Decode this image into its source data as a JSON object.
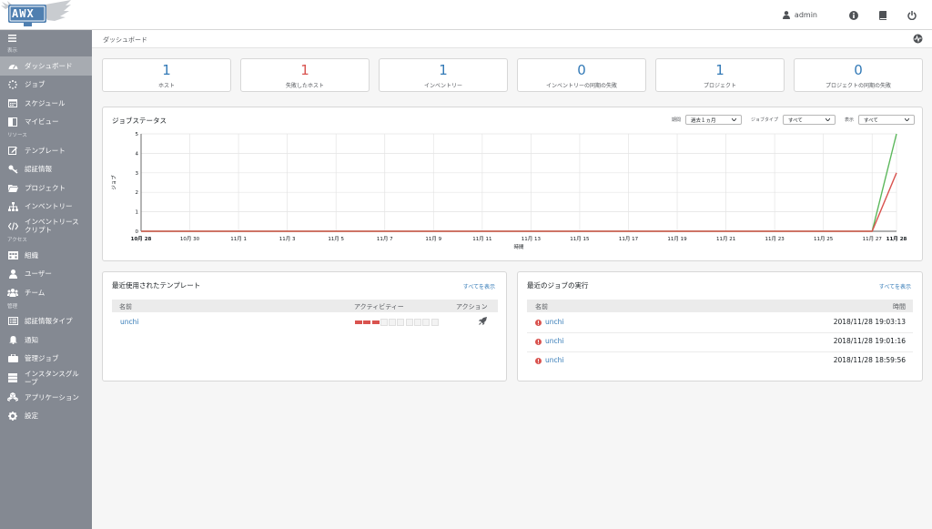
{
  "header": {
    "logo_text": "AWX",
    "username": "admin"
  },
  "sidebar": {
    "sections": [
      {
        "label": "表示",
        "items": [
          {
            "label": "ダッシュボード",
            "icon": "tachometer-icon",
            "active": true
          },
          {
            "label": "ジョブ",
            "icon": "spinner-icon"
          },
          {
            "label": "スケジュール",
            "icon": "calendar-icon"
          },
          {
            "label": "マイビュー",
            "icon": "columns-icon"
          }
        ]
      },
      {
        "label": "リソース",
        "items": [
          {
            "label": "テンプレート",
            "icon": "pencil-square-icon"
          },
          {
            "label": "認証情報",
            "icon": "key-icon"
          },
          {
            "label": "プロジェクト",
            "icon": "folder-icon"
          },
          {
            "label": "インベントリー",
            "icon": "sitemap-icon"
          },
          {
            "label": "インベントリースクリプト",
            "icon": "code-icon"
          }
        ]
      },
      {
        "label": "アクセス",
        "items": [
          {
            "label": "組織",
            "icon": "building-icon"
          },
          {
            "label": "ユーザー",
            "icon": "user-icon"
          },
          {
            "label": "チーム",
            "icon": "users-icon"
          }
        ]
      },
      {
        "label": "管理",
        "items": [
          {
            "label": "認証情報タイプ",
            "icon": "list-alt-icon"
          },
          {
            "label": "通知",
            "icon": "bell-icon"
          },
          {
            "label": "管理ジョブ",
            "icon": "briefcase-icon"
          },
          {
            "label": "インスタンスグループ",
            "icon": "server-icon"
          },
          {
            "label": "アプリケーション",
            "icon": "cubes-icon"
          },
          {
            "label": "設定",
            "icon": "cog-icon"
          }
        ]
      }
    ]
  },
  "breadcrumb": "ダッシュボード",
  "counts": [
    {
      "value": "1",
      "label": "ホスト"
    },
    {
      "value": "1",
      "label": "失敗したホスト",
      "status": "fail"
    },
    {
      "value": "1",
      "label": "インベントリー"
    },
    {
      "value": "0",
      "label": "インベントリーの同期の失敗"
    },
    {
      "value": "1",
      "label": "プロジェクト"
    },
    {
      "value": "0",
      "label": "プロジェクトの同期の失敗"
    }
  ],
  "job_status": {
    "title": "ジョブステータス",
    "filters": {
      "period_label": "期間",
      "period_value": "過去１ヵ月",
      "job_type_label": "ジョブタイプ",
      "job_type_value": "すべて",
      "view_label": "表示",
      "view_value": "すべて"
    }
  },
  "chart_data": {
    "type": "line",
    "xlabel": "時間",
    "ylabel": "ジョブ",
    "x_tick_labels": [
      "10月 28",
      "10月 30",
      "11月 1",
      "11月 3",
      "11月 5",
      "11月 7",
      "11月 9",
      "11月 11",
      "11月 13",
      "11月 15",
      "11月 17",
      "11月 19",
      "11月 21",
      "11月 23",
      "11月 25",
      "11月 27",
      "11月 28"
    ],
    "y_ticks": [
      0,
      1,
      2,
      3,
      4,
      5
    ],
    "ylim": [
      0,
      5
    ],
    "x_days": 31,
    "grid": true,
    "series": [
      {
        "color": "#5cb85c",
        "points": [
          [
            0,
            0
          ],
          [
            30,
            0
          ],
          [
            31,
            5
          ]
        ]
      },
      {
        "color": "#d9534f",
        "points": [
          [
            0,
            0
          ],
          [
            30,
            0
          ],
          [
            31,
            3
          ]
        ]
      }
    ]
  },
  "recent_templates": {
    "title": "最近使用されたテンプレート",
    "see_all": "すべてを表示",
    "columns": {
      "name": "名前",
      "activity": "アクティビティー",
      "action": "アクション"
    },
    "rows": [
      {
        "name": "unchi",
        "activity": [
          "failed",
          "failed",
          "failed",
          "none",
          "none",
          "none",
          "none",
          "none",
          "none",
          "none"
        ]
      }
    ]
  },
  "recent_jobs": {
    "title": "最近のジョブの実行",
    "see_all": "すべてを表示",
    "columns": {
      "name": "名前",
      "time": "時間"
    },
    "rows": [
      {
        "name": "unchi",
        "time": "2018/11/28 19:03:13",
        "status": "failed"
      },
      {
        "name": "unchi",
        "time": "2018/11/28 19:01:16",
        "status": "failed"
      },
      {
        "name": "unchi",
        "time": "2018/11/28 18:59:56",
        "status": "failed"
      }
    ]
  }
}
